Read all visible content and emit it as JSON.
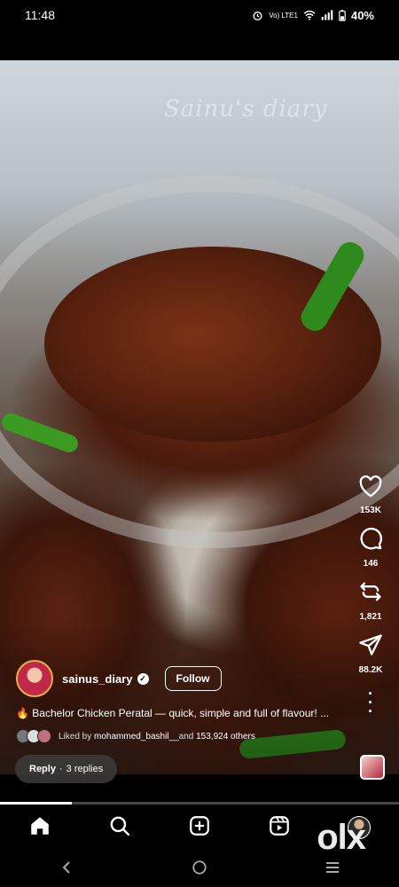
{
  "status_bar": {
    "time": "11:48",
    "network": "Vo) LTE1",
    "battery": "40%"
  },
  "video": {
    "watermark": "Sainu's diary"
  },
  "actions": {
    "likes_count": "153K",
    "comments_count": "146",
    "reposts_count": "1,821",
    "shares_count": "88.2K"
  },
  "author": {
    "username": "sainus_diary",
    "follow_label": "Follow"
  },
  "caption": {
    "text": "🔥 Bachelor Chicken Peratal — quick, simple and full of flavour! ..."
  },
  "likes_line": {
    "prefix": "Liked by ",
    "first_user": "mohammed_bashil__",
    "middle": " and ",
    "others": "153,924 others"
  },
  "reply": {
    "label": "Reply",
    "separator": "·",
    "count": "3 replies"
  },
  "playback": {
    "progress": 0.18
  },
  "nav": {
    "items": [
      "home-icon",
      "search-icon",
      "create-icon",
      "reels-icon",
      "profile-avatar"
    ]
  },
  "overlay": {
    "olx_logo": "olx"
  }
}
